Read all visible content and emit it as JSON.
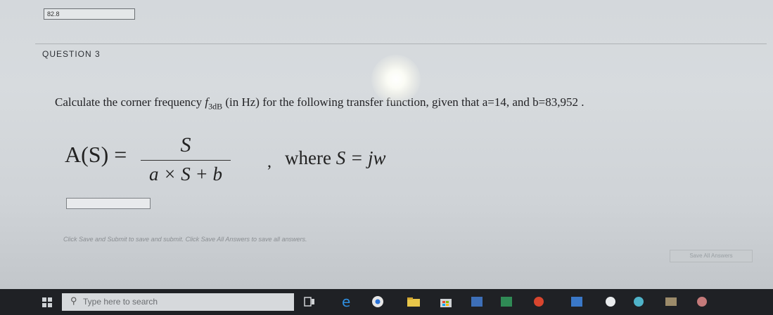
{
  "previous_answer": {
    "value": "82.8"
  },
  "question": {
    "label": "QUESTION 3",
    "text_before": "Calculate the corner frequency ",
    "symbol_f": "f",
    "symbol_sub": "3dB",
    "text_after": " (in Hz) for the following transfer function, given that a=14, and b=83,952 ."
  },
  "formula": {
    "lhs": "A(S) =",
    "numerator": "S",
    "denominator": "a × S + b",
    "comma": ",",
    "where_text": "where ",
    "where_expr": "S = jw"
  },
  "answer_field": {
    "value": ""
  },
  "footer": {
    "instruction": "Click Save and Submit to save and submit. Click Save All Answers to save all answers.",
    "save_all_label": "Save All Answers"
  },
  "taskbar": {
    "search_placeholder": "Type here to search",
    "icons": [
      "task-view-icon",
      "edge-icon",
      "chrome-icon",
      "file-explorer-icon",
      "store-icon",
      "word-icon",
      "excel-icon",
      "app-icon",
      "app-icon",
      "app-icon",
      "app-icon",
      "app-icon",
      "app-icon"
    ]
  },
  "colors": {
    "screen_bg": "#d4d8dc",
    "taskbar_bg": "#1f2125",
    "text": "#232326"
  }
}
